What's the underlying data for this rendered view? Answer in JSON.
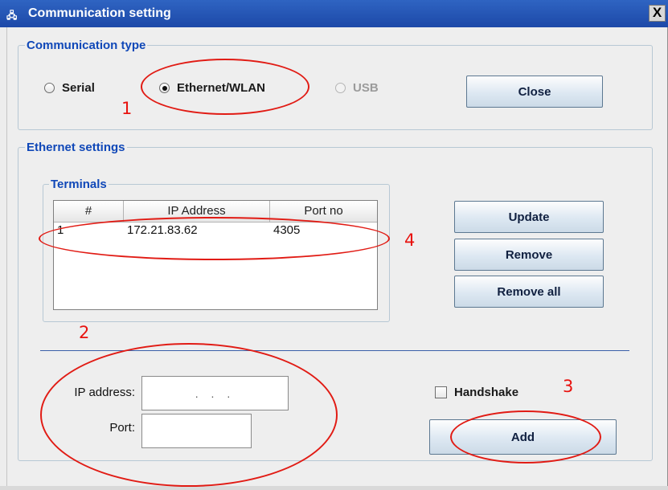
{
  "window": {
    "title_icon": "🖧",
    "title": "Communication setting",
    "close_glyph": "X"
  },
  "communication_type": {
    "legend": "Communication type",
    "options": [
      {
        "label": "Serial",
        "checked": false,
        "enabled": true
      },
      {
        "label": "Ethernet/WLAN",
        "checked": true,
        "enabled": true
      },
      {
        "label": "USB",
        "checked": false,
        "enabled": false
      }
    ],
    "close_button": "Close"
  },
  "ethernet_settings": {
    "legend": "Ethernet settings",
    "terminals": {
      "legend": "Terminals",
      "columns": [
        "#",
        "IP Address",
        "Port no"
      ],
      "rows": [
        {
          "num": "1",
          "ip": "172.21.83.62",
          "port": "4305"
        }
      ]
    },
    "buttons": {
      "update": "Update",
      "remove": "Remove",
      "remove_all": "Remove all"
    },
    "ip_label": "IP address:",
    "ip_value": ". . .",
    "port_label": "Port:",
    "port_value": "",
    "handshake_label": "Handshake",
    "handshake_checked": false,
    "add_button": "Add"
  },
  "annotations": {
    "color": "#e8120e",
    "labels": [
      "1",
      "2",
      "3",
      "4"
    ]
  }
}
